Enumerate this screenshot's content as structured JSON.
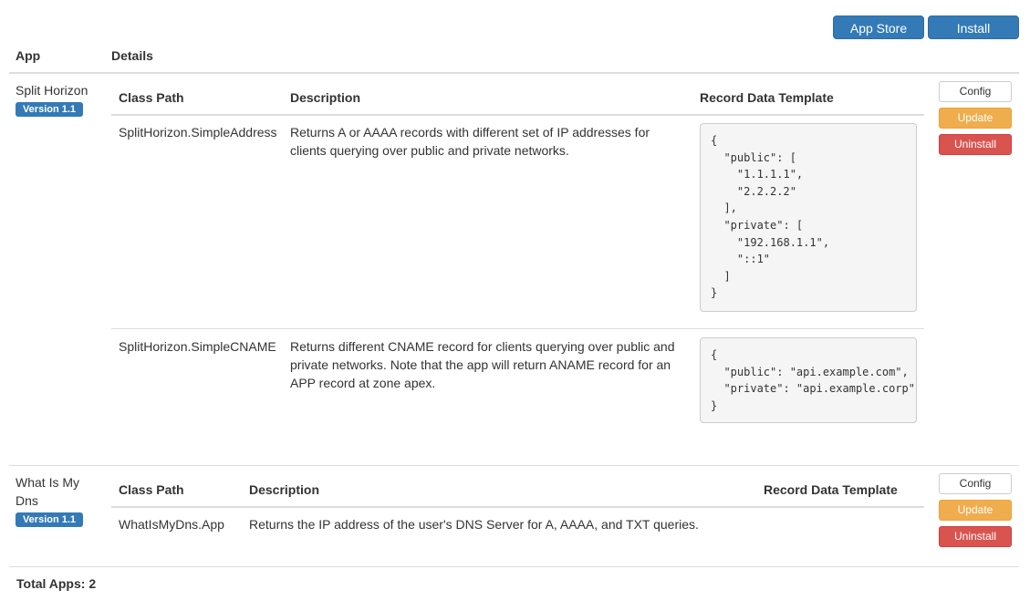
{
  "toolbar": {
    "app_store_label": "App Store",
    "install_label": "Install"
  },
  "table": {
    "col_app": "App",
    "col_details": "Details"
  },
  "inner_headers": {
    "class_path": "Class Path",
    "description": "Description",
    "record_template": "Record Data Template"
  },
  "apps": [
    {
      "name": "Split Horizon",
      "version": "Version 1.1",
      "buttons": {
        "config": "Config",
        "update": "Update",
        "uninstall": "Uninstall"
      },
      "classes": [
        {
          "path": "SplitHorizon.SimpleAddress",
          "description": "Returns A or AAAA records with different set of IP addresses for clients querying over public and private networks.",
          "template": "{\n  \"public\": [\n    \"1.1.1.1\",\n    \"2.2.2.2\"\n  ],\n  \"private\": [\n    \"192.168.1.1\",\n    \"::1\"\n  ]\n}"
        },
        {
          "path": "SplitHorizon.SimpleCNAME",
          "description": "Returns different CNAME record for clients querying over public and private networks. Note that the app will return ANAME record for an APP record at zone apex.",
          "template": "{\n  \"public\": \"api.example.com\",\n  \"private\": \"api.example.corp\"\n}"
        }
      ]
    },
    {
      "name": "What Is My Dns",
      "version": "Version 1.1",
      "buttons": {
        "config": "Config",
        "update": "Update",
        "uninstall": "Uninstall"
      },
      "classes": [
        {
          "path": "WhatIsMyDns.App",
          "description": "Returns the IP address of the user's DNS Server for A, AAAA, and TXT queries."
        }
      ]
    }
  ],
  "footer": {
    "total_apps": "Total Apps: 2"
  }
}
